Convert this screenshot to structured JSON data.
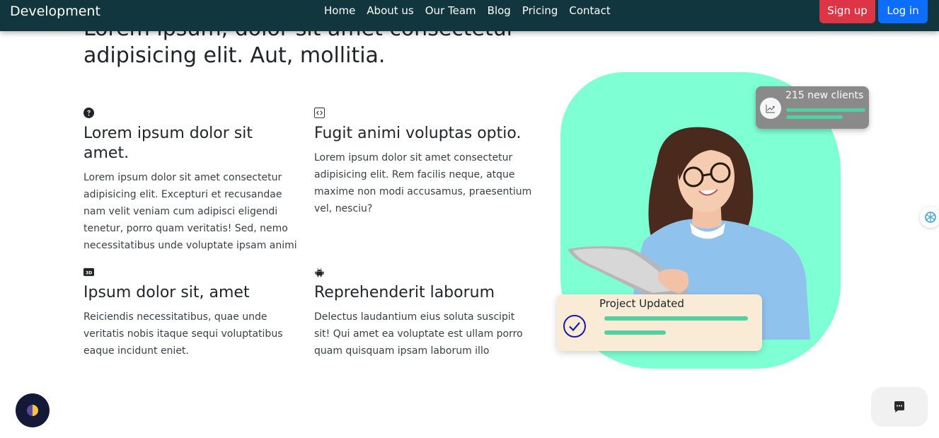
{
  "navbar": {
    "brand": "Development",
    "links": [
      "Home",
      "About us",
      "Our Team",
      "Blog",
      "Pricing",
      "Contact"
    ],
    "signup_label": "Sign up",
    "login_label": "Log in",
    "background": "#11363d"
  },
  "heading": "Lorem ipsum, dolor sit amet consectetur adipisicing elit. Aut, mollitia.",
  "features": [
    {
      "icon": "question-circle-icon",
      "title": "Lorem ipsum dolor sit amet.",
      "text": "Lorem ipsum dolor sit amet consectetur adipisicing elit. Excepturi et recusandae nam velit veniam cum adipisci eligendi tenetur, porro quam veritatis! Sed, nemo necessitatibus unde voluptate ipsam animi"
    },
    {
      "icon": "code-square-icon",
      "title": "Fugit animi voluptas optio.",
      "text": "Lorem ipsum dolor sit amet consectetur adipisicing elit. Rem facilis neque, atque maxime non modi accusamus, praesentium vel, nesciu?"
    },
    {
      "icon": "3d-badge-icon",
      "title": "Ipsum dolor sit, amet",
      "text": "Reiciendis necessitatibus, quae unde veritatis nobis itaque sequi voluptatibus eaque incidunt eniet."
    },
    {
      "icon": "android-icon",
      "title": "Reprehenderit laborum",
      "text": "Delectus laudantium eius soluta suscipit sit! Qui amet ea voluptate est ullam porro quam quisquam ipsam laborum illo"
    }
  ],
  "hero": {
    "clients_card": {
      "text": "215 new clients",
      "icon": "trending-up-icon"
    },
    "project_card": {
      "text": "Project Updated",
      "icon": "check-circle-icon"
    },
    "accent": "#7fffd4",
    "bar_color": "#4fd1a1"
  },
  "floating": {
    "theme_icon": "half-moon-icon",
    "chat_icon": "chat-bubble-icon",
    "side_icon": "openai-icon"
  },
  "colors": {
    "signup": "#dc3545",
    "login": "#0d6efd"
  }
}
